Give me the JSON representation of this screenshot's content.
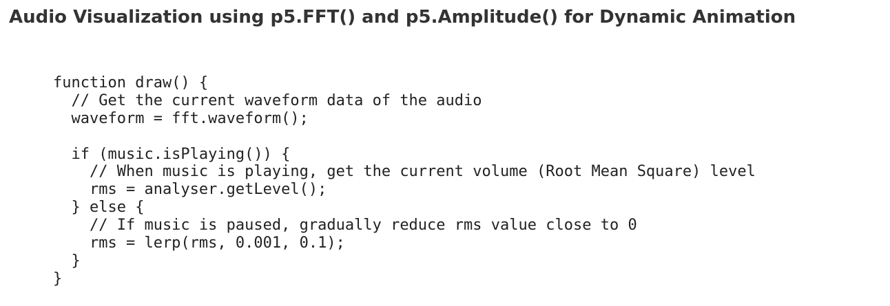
{
  "page": {
    "title": "Audio Visualization using p5.FFT() and p5.Amplitude() for Dynamic Animation"
  },
  "code": {
    "language": "javascript",
    "lines": [
      "function draw() {",
      "  // Get the current waveform data of the audio",
      "  waveform = fft.waveform();",
      "",
      "  if (music.isPlaying()) {",
      "    // When music is playing, get the current volume (Root Mean Square) level",
      "    rms = analyser.getLevel();",
      "  } else {",
      "    // If music is paused, gradually reduce rms value close to 0",
      "    rms = lerp(rms, 0.001, 0.1);",
      "  }",
      "}"
    ]
  }
}
